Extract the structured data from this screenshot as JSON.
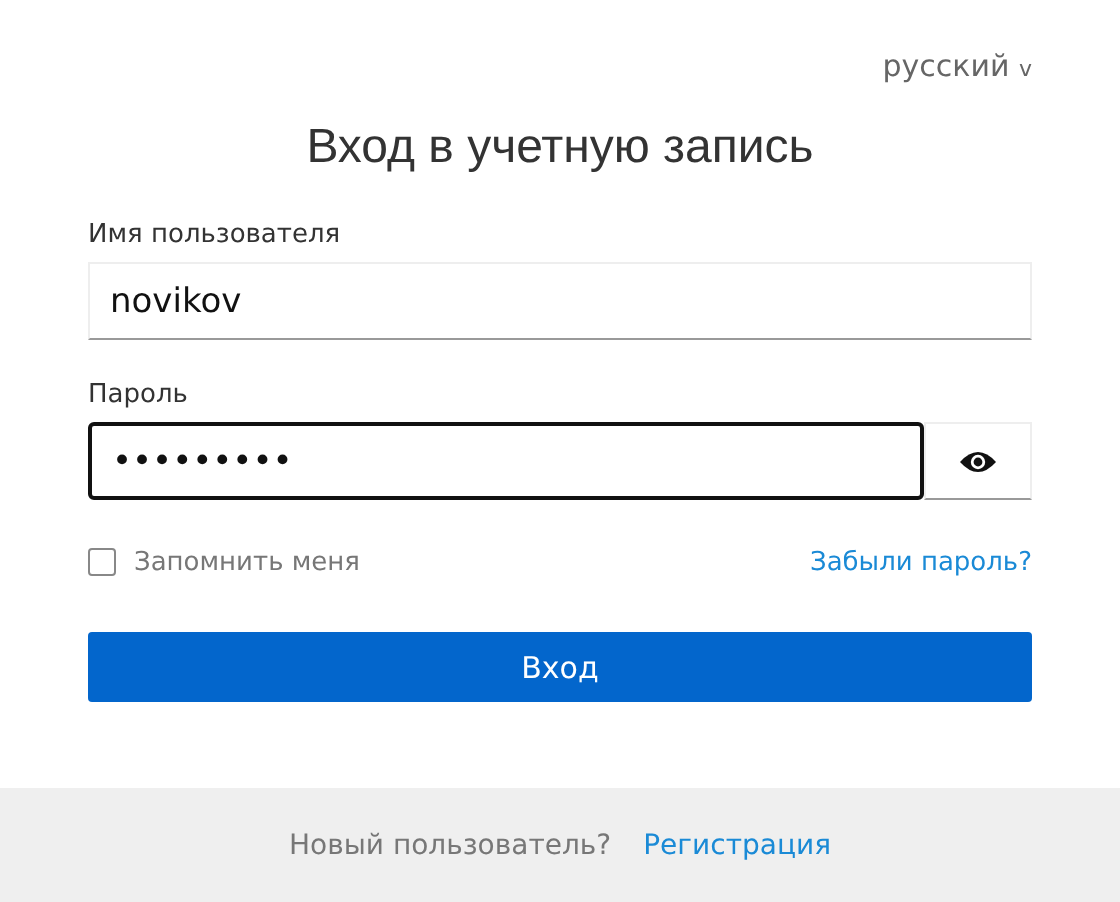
{
  "language": {
    "label": "русский",
    "caret": "v"
  },
  "title": "Вход в учетную запись",
  "username": {
    "label": "Имя пользователя",
    "value": "novikov",
    "focused": false
  },
  "password": {
    "label": "Пароль",
    "value": "•••••••••",
    "focused": true
  },
  "remember": {
    "label": "Запомнить меня",
    "checked": false
  },
  "forgot_link": "Забыли пароль?",
  "submit_button": "Вход",
  "footer": {
    "text": "Новый пользователь?",
    "link": "Регистрация"
  }
}
